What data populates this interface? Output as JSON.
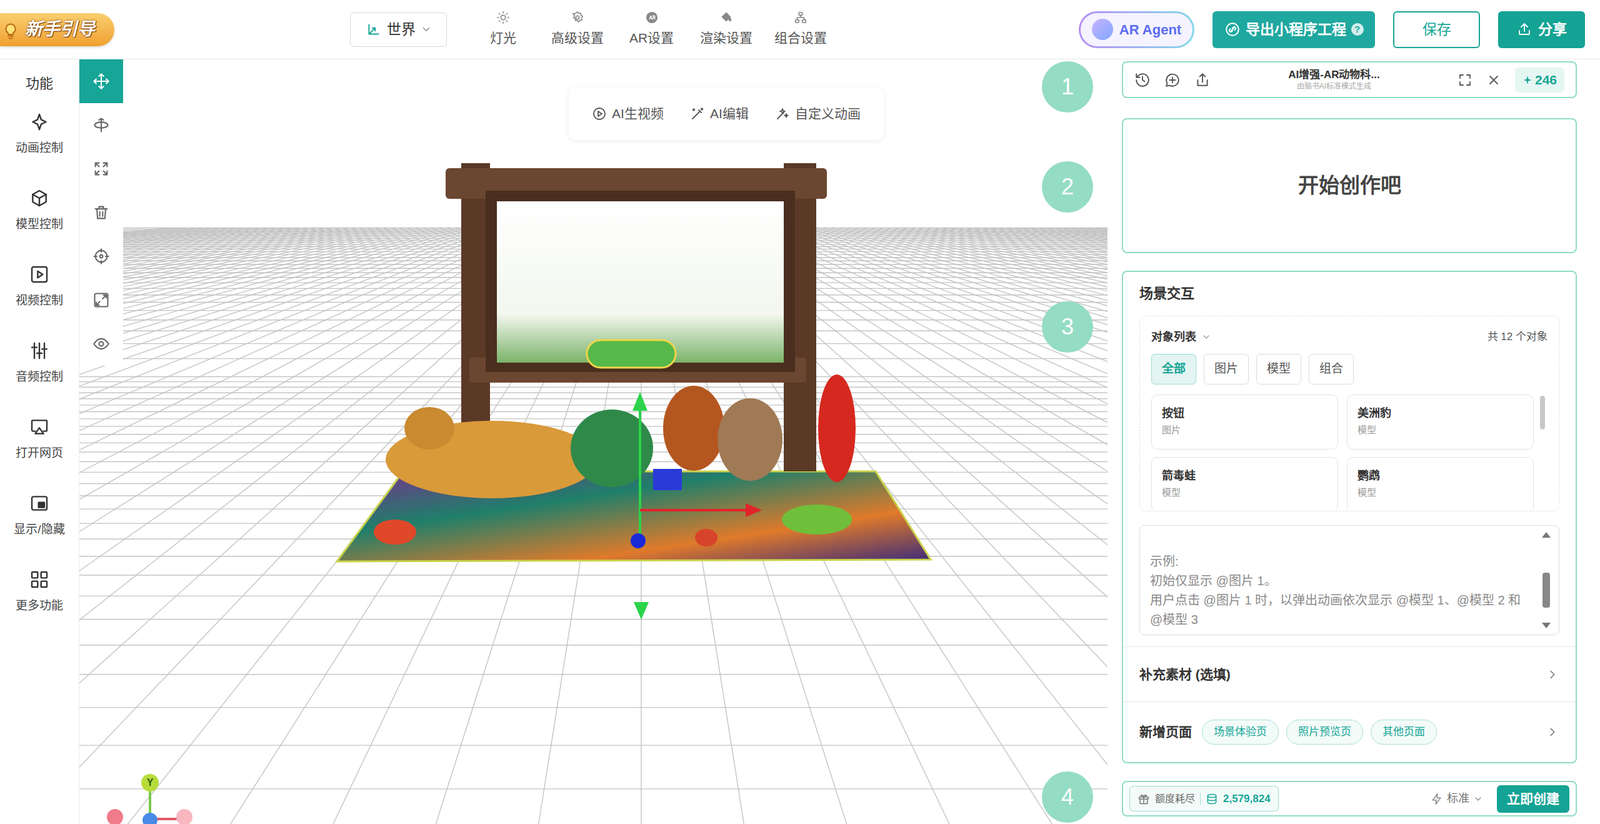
{
  "header": {
    "guide": "新手引导",
    "scope": "世界",
    "tools": [
      {
        "label": "灯光"
      },
      {
        "label": "高级设置"
      },
      {
        "label": "AR设置"
      },
      {
        "label": "渲染设置"
      },
      {
        "label": "组合设置"
      }
    ],
    "agent": "AR Agent",
    "export": "导出小程序工程",
    "export_help": "?",
    "save": "保存",
    "share": "分享"
  },
  "sidebar": {
    "title": "功能",
    "items": [
      {
        "label": "动画控制"
      },
      {
        "label": "模型控制"
      },
      {
        "label": "视频控制"
      },
      {
        "label": "音频控制"
      },
      {
        "label": "打开网页"
      },
      {
        "label": "显示/隐藏"
      },
      {
        "label": "更多功能"
      }
    ]
  },
  "toolbar": {
    "tools": [
      {
        "selected": true
      },
      {
        "selected": false
      },
      {
        "selected": false
      },
      {
        "selected": false
      },
      {
        "selected": false
      },
      {
        "selected": false
      },
      {
        "selected": false
      }
    ]
  },
  "canvas_actions": [
    {
      "label": "AI生视频"
    },
    {
      "label": "AI编辑"
    },
    {
      "label": "自定义动画"
    }
  ],
  "gizmo": {
    "axis": "Y"
  },
  "steps": [
    "1",
    "2",
    "3",
    "4"
  ],
  "session": {
    "title": "AI增强-AR动物科...",
    "subtitle": "由脑书AI标准模式生成",
    "credits": "246"
  },
  "prompt": {
    "title": "开始创作吧"
  },
  "scene": {
    "title": "场景交互",
    "list_label": "对象列表",
    "count": "共 12 个对象",
    "filters": [
      {
        "label": "全部",
        "selected": true
      },
      {
        "label": "图片",
        "selected": false
      },
      {
        "label": "模型",
        "selected": false
      },
      {
        "label": "组合",
        "selected": false
      }
    ],
    "objects": [
      {
        "name": "按钮",
        "type": "图片"
      },
      {
        "name": "美洲豹",
        "type": "模型"
      },
      {
        "name": "箭毒蛙",
        "type": "模型"
      },
      {
        "name": "鹦鹉",
        "type": "模型"
      }
    ]
  },
  "instructions": {
    "lines": [
      "示例:",
      "初始仅显示 @图片 1。",
      "用户点击 @图片 1 时，以弹出动画依次显示 @模型 1、@模型 2 和 @模型 3"
    ]
  },
  "materials": {
    "label": "补充素材 (选填)"
  },
  "pages": {
    "label": "新增页面",
    "chips": [
      {
        "label": "场景体验页"
      },
      {
        "label": "照片预览页"
      },
      {
        "label": "其他页面"
      }
    ]
  },
  "footer": {
    "quota": "额度耗尽",
    "balance": "2,579,824",
    "mode": "标准",
    "create": "立即创建"
  }
}
